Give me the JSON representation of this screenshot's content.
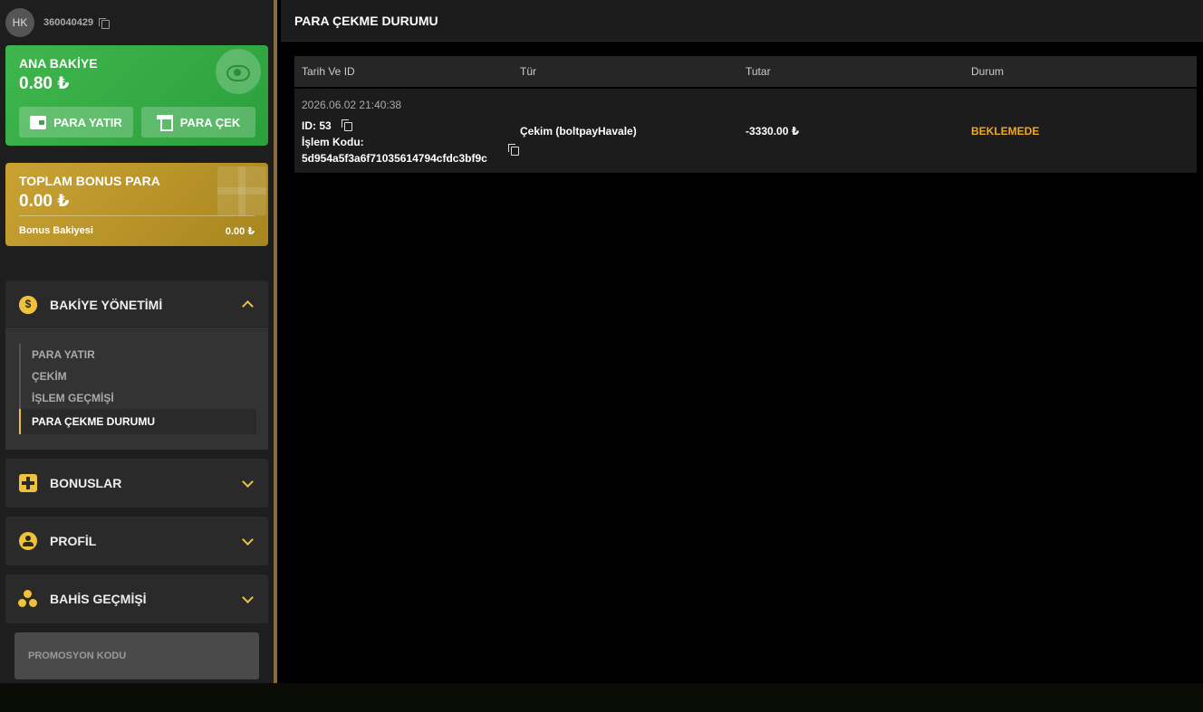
{
  "user": {
    "initials": "HK",
    "id": "360040429"
  },
  "main_balance": {
    "label": "ANA BAKİYE",
    "amount": "0.80 ₺",
    "deposit_label": "PARA YATIR",
    "withdraw_label": "PARA ÇEK"
  },
  "bonus_balance": {
    "label": "TOPLAM BONUS PARA",
    "amount": "0.00 ₺",
    "sub_label": "Bonus Bakiyesi",
    "sub_amount": "0.00 ₺"
  },
  "menu": {
    "balance_management": {
      "title": "BAKİYE YÖNETİMİ",
      "items": [
        "PARA YATIR",
        "ÇEKİM",
        "İŞLEM GEÇMİŞİ",
        "PARA ÇEKME DURUMU"
      ]
    },
    "bonuses": "BONUSLAR",
    "profile": "PROFİL",
    "bet_history": "BAHİS GEÇMİŞİ"
  },
  "promo_placeholder": "PROMOSYON KODU",
  "page_title": "PARA ÇEKME DURUMU",
  "table": {
    "headers": [
      "Tarih Ve ID",
      "Tür",
      "Tutar",
      "Durum"
    ],
    "rows": [
      {
        "date": "2026.06.02 21:40:38",
        "id": "ID: 53",
        "code_label": "İşlem Kodu:",
        "code": "5d954a5f3a6f71035614794cfdc3bf9c",
        "type": "Çekim (boltpayHavale)",
        "amount": "-3330.00 ₺",
        "status": "BEKLEMEDE"
      }
    ]
  },
  "colors": {
    "accent": "#f0c23c",
    "green": "#3fb64d",
    "gold": "#c9a233",
    "status_pending": "#f0a825"
  }
}
